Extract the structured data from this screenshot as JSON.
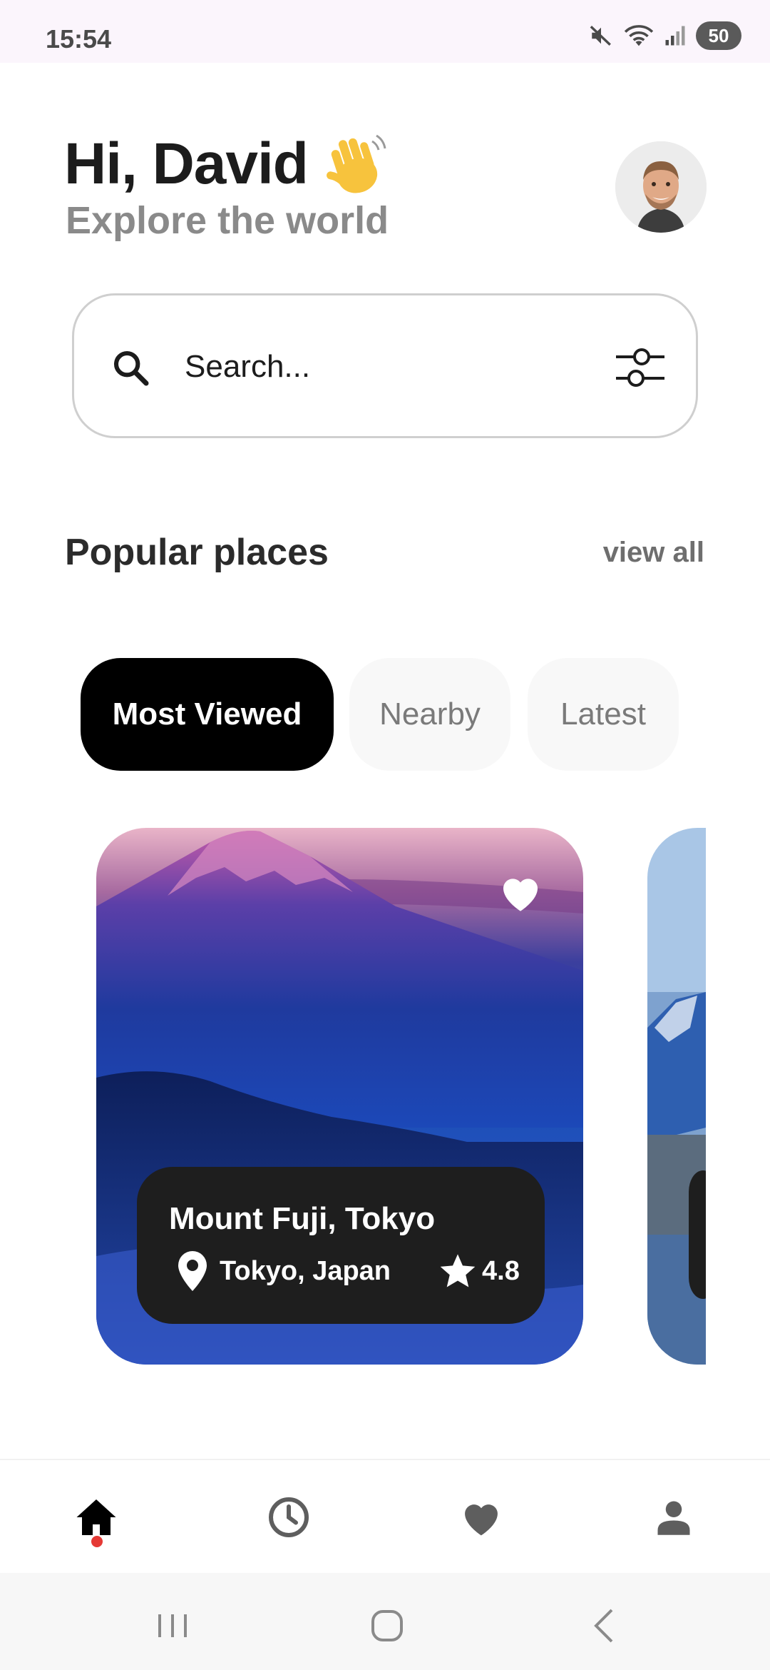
{
  "status_bar": {
    "time": "15:54",
    "battery": "50",
    "icons": [
      "mute-icon",
      "wifi-icon",
      "signal-icon",
      "battery-icon"
    ]
  },
  "header": {
    "greeting": "Hi, David",
    "greeting_emoji_icon": "waving-hand-icon",
    "subtitle": "Explore the world",
    "avatar_icon": "user-avatar"
  },
  "search": {
    "placeholder": "Search...",
    "icon": "search-icon",
    "filter_icon": "filter-sliders-icon"
  },
  "section": {
    "title": "Popular places",
    "view_all": "view all"
  },
  "tabs": [
    {
      "label": "Most Viewed",
      "active": true
    },
    {
      "label": "Nearby",
      "active": false
    },
    {
      "label": "Latest",
      "active": false
    }
  ],
  "places": [
    {
      "title": "Mount Fuji, Tokyo",
      "location": "Tokyo, Japan",
      "rating": "4.8",
      "favorite": true
    }
  ],
  "bottom_nav": {
    "items": [
      "home-icon",
      "history-clock-icon",
      "favorites-heart-icon",
      "profile-person-icon"
    ],
    "active_index": 0
  },
  "colors": {
    "accent_dot": "#e53935",
    "active_tab_bg": "#000000",
    "info_panel_bg": "#1e1e1e"
  }
}
